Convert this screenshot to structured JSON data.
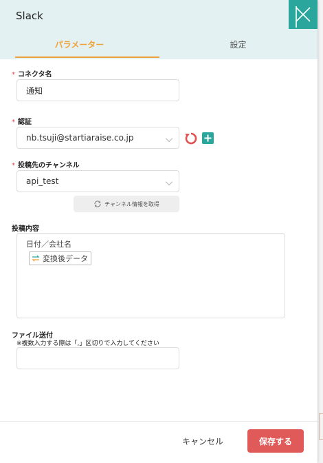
{
  "dialog": {
    "title": "Slack",
    "close_icon": "close-x-icon"
  },
  "tabs": [
    {
      "label": "パラメーター",
      "active": true
    },
    {
      "label": "設定",
      "active": false
    }
  ],
  "fields": {
    "connector_name": {
      "label": "コネクタ名",
      "required": true,
      "value": "通知"
    },
    "auth": {
      "label": "認証",
      "required": true,
      "value": "nb.tsuji@startiaraise.co.jp"
    },
    "channel": {
      "label": "投稿先のチャンネル",
      "required": true,
      "value": "api_test"
    },
    "fetch_channel_button": "チャンネル情報を取得",
    "post_content": {
      "label": "投稿内容",
      "text": "日付／会社名",
      "chip": "変換後データ"
    },
    "file_send": {
      "label": "ファイル送付",
      "hint": "※複数入力する際は「,」区切りで入力してください",
      "value": ""
    }
  },
  "footer": {
    "cancel_label": "キャンセル",
    "save_label": "保存する"
  },
  "colors": {
    "header_bg": "#e4f1f2",
    "accent_teal": "#2aa69d",
    "active_tab": "#f0a23a",
    "required_mark": "#e05050",
    "save_button": "#e05a5a"
  }
}
